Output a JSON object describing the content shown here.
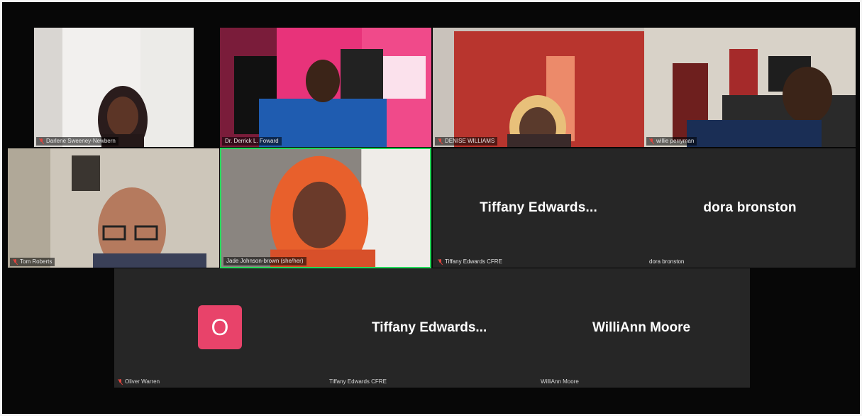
{
  "participants": [
    {
      "name": "Darlene Sweeney-Newbern",
      "muted": true,
      "video": true
    },
    {
      "name": "Dr. Derrick L. Foward",
      "muted": false,
      "video": true
    },
    {
      "name": "DENISE WILLIAMS",
      "muted": true,
      "video": true
    },
    {
      "name": "willie perryman",
      "muted": true,
      "video": true
    },
    {
      "name": "Tom Roberts",
      "muted": true,
      "video": true
    },
    {
      "name": "Jade Johnson-brown (she/her)",
      "muted": false,
      "video": true,
      "active_speaker": true
    },
    {
      "name": "Tiffany Edwards CFRE",
      "display_name": "Tiffany  Edwards...",
      "muted": true,
      "video": false
    },
    {
      "name": "dora bronston",
      "display_name": "dora bronston",
      "muted": false,
      "video": false
    }
  ],
  "bottom_tile": {
    "oliver": {
      "name": "Oliver Warren",
      "avatar_letter": "O",
      "muted": true
    },
    "tiffany": {
      "name": "Tiffany Edwards CFRE",
      "display_name": "Tiffany  Edwards..."
    },
    "williann": {
      "name": "WilliAnn Moore",
      "display_name": "WilliAnn Moore"
    }
  },
  "colors": {
    "background": "#070707",
    "tile": "#262626",
    "active_border": "#23d959",
    "avatar": "#e8436a",
    "muted_icon": "#e0443e"
  }
}
